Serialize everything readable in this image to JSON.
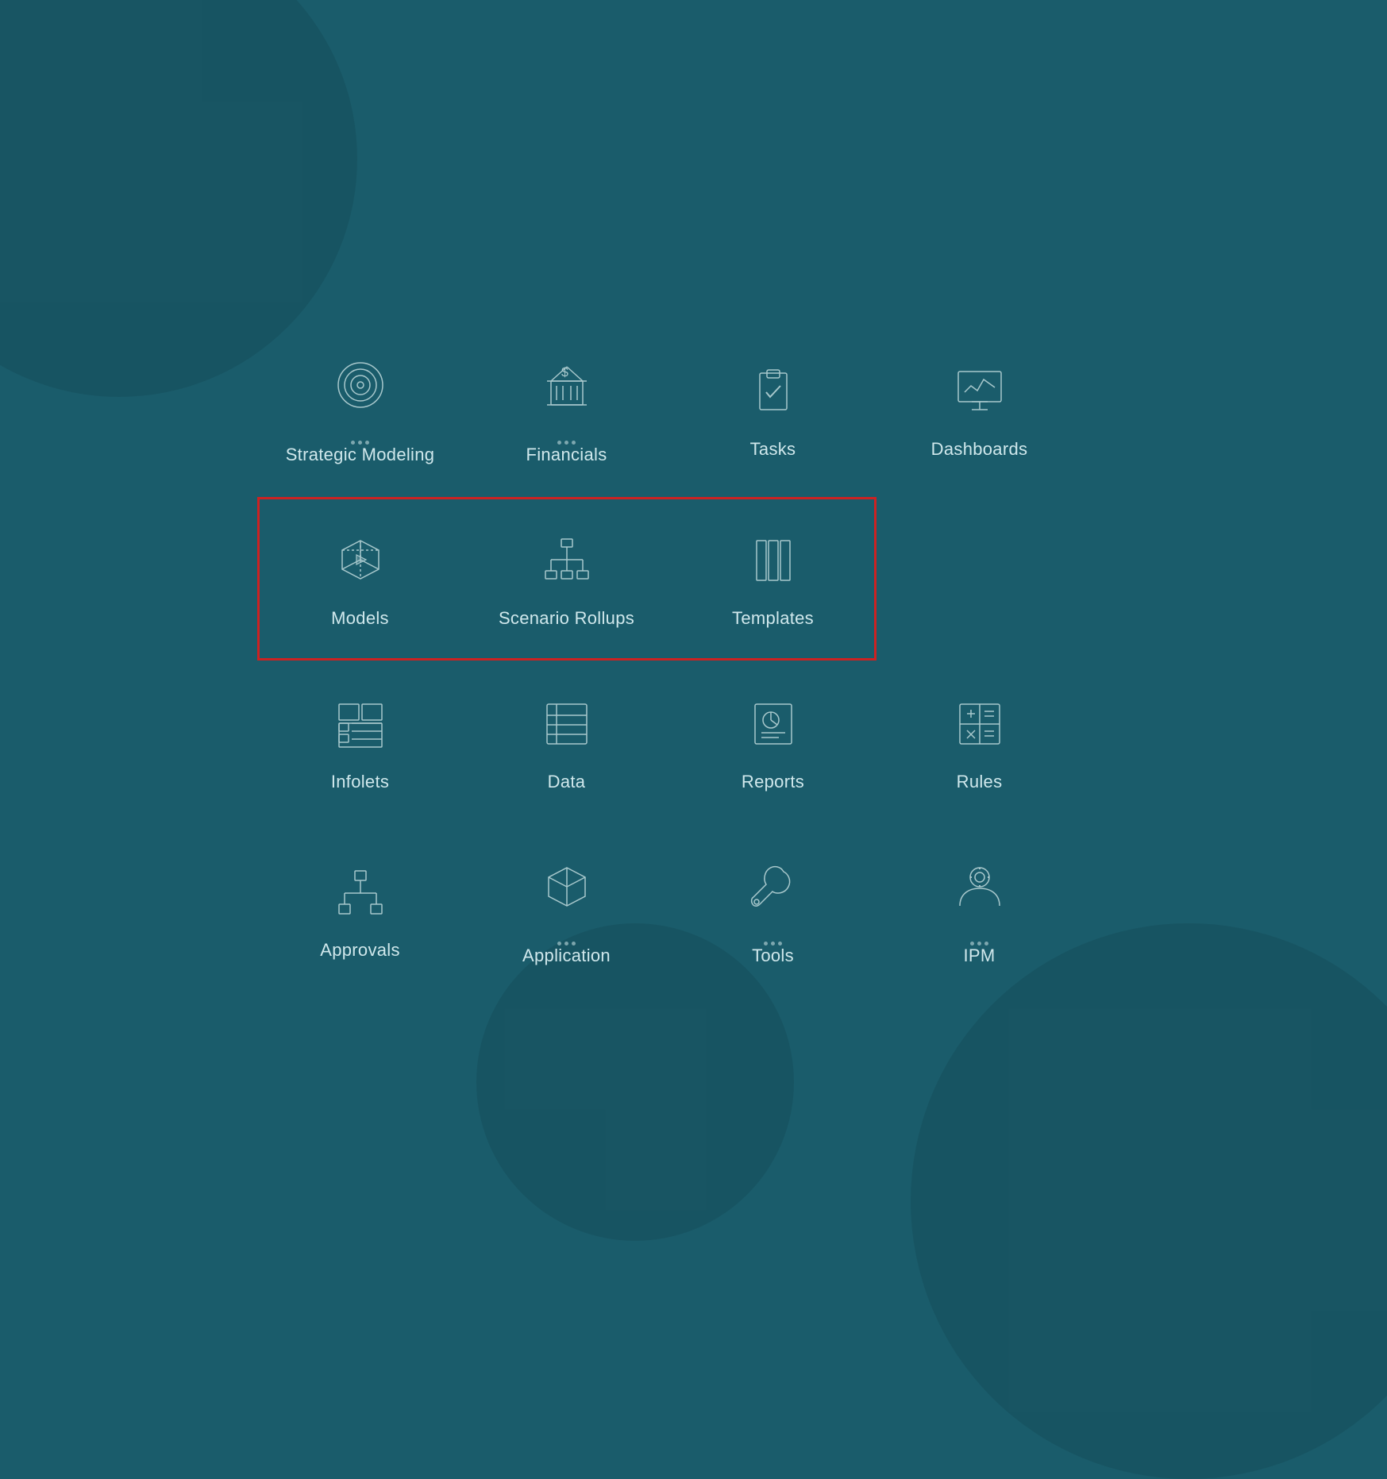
{
  "colors": {
    "bg": "#1a5c6b",
    "icon_stroke": "#a8c8cc",
    "label": "#d0e8ec",
    "highlight_border": "#cc2222"
  },
  "rows": [
    {
      "id": "row1",
      "items": [
        {
          "id": "strategic-modeling",
          "label": "Strategic Modeling",
          "icon": "target",
          "dots": true
        },
        {
          "id": "financials",
          "label": "Financials",
          "icon": "bank",
          "dots": true
        },
        {
          "id": "tasks",
          "label": "Tasks",
          "icon": "clipboard-check",
          "dots": false
        },
        {
          "id": "dashboards",
          "label": "Dashboards",
          "icon": "monitor-chart",
          "dots": false
        }
      ]
    },
    {
      "id": "row2",
      "highlighted": true,
      "items": [
        {
          "id": "models",
          "label": "Models",
          "icon": "cube-3d",
          "dots": false
        },
        {
          "id": "scenario-rollups",
          "label": "Scenario Rollups",
          "icon": "org-chart",
          "dots": false
        },
        {
          "id": "templates",
          "label": "Templates",
          "icon": "books",
          "dots": false
        },
        {
          "id": "empty",
          "label": "",
          "icon": "",
          "dots": false
        }
      ]
    },
    {
      "id": "row3",
      "items": [
        {
          "id": "infolets",
          "label": "Infolets",
          "icon": "infolets",
          "dots": false
        },
        {
          "id": "data",
          "label": "Data",
          "icon": "data-list",
          "dots": false
        },
        {
          "id": "reports",
          "label": "Reports",
          "icon": "report-chart",
          "dots": false
        },
        {
          "id": "rules",
          "label": "Rules",
          "icon": "calculator-grid",
          "dots": false
        }
      ]
    },
    {
      "id": "row4",
      "items": [
        {
          "id": "approvals",
          "label": "Approvals",
          "icon": "approvals-tree",
          "dots": false
        },
        {
          "id": "application",
          "label": "Application",
          "icon": "package-3d",
          "dots": true
        },
        {
          "id": "tools",
          "label": "Tools",
          "icon": "wrench",
          "dots": true
        },
        {
          "id": "ipm",
          "label": "IPM",
          "icon": "person-settings",
          "dots": true
        }
      ]
    }
  ]
}
